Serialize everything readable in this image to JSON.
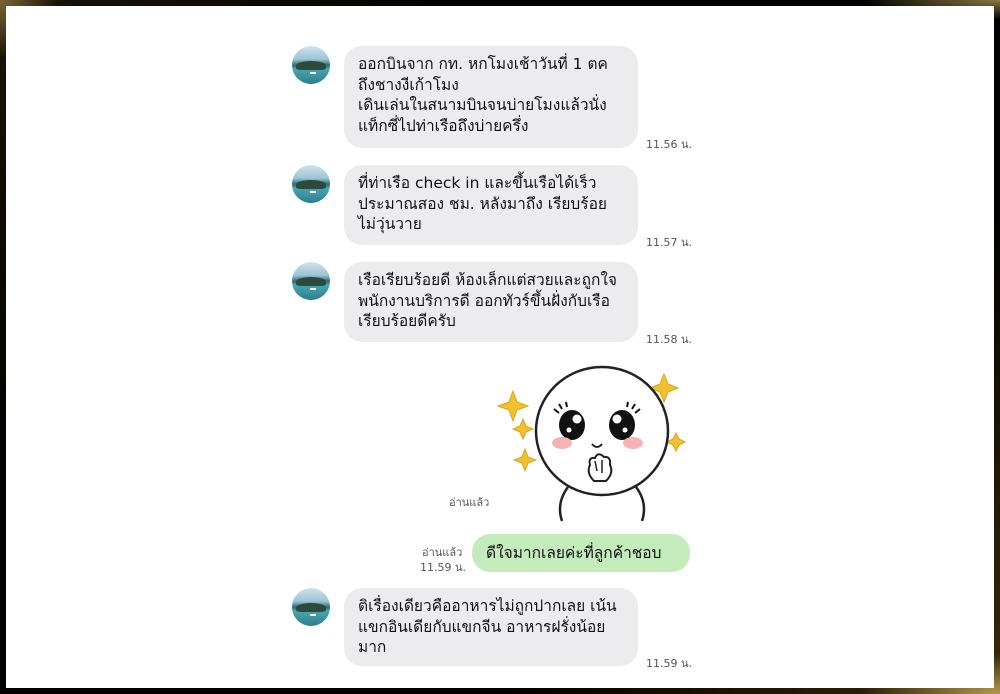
{
  "messages": [
    {
      "lines": [
        "ออกบินจาก กท. หกโมงเช้าวันที่ 1 ตค",
        "ถึงชางงีเก้าโมง",
        "เดินเล่นในสนามบินจนบ่ายโมงแล้วนั่ง",
        "แท็กซี่ไปท่าเรือถึงบ่ายครึ่ง"
      ],
      "time": "11.56 น."
    },
    {
      "lines": [
        "ที่ท่าเรือ check in และขึ้นเรือได้เร็ว",
        "ประมาณสอง ชม. หลังมาถึง เรียบร้อย",
        "ไม่วุ่นวาย"
      ],
      "time": "11.57 น."
    },
    {
      "lines": [
        "เรือเรียบร้อยดี ห้องเล็กแต่สวยและถูกใจ",
        "พนักงานบริการดี ออกทัวร์ขึ้นฝั่งกับเรือ",
        "เรียบร้อยดีครับ"
      ],
      "time": "11.58 น."
    },
    {
      "lines": [
        "ติเรื่องเดียวคืออาหารไม่ถูกปากเลย เน้น",
        "แขกอินเดียกับแขกจีน อาหารฝรั่งน้อย",
        "มาก"
      ],
      "time": "11.59 น."
    }
  ],
  "sticker": {
    "read_label": "อ่านแล้ว",
    "icon": "happy-face-sticker",
    "star_color": "#f2c12e"
  },
  "reply": {
    "read_label": "อ่านแล้ว",
    "time": "11.59 น.",
    "text": "ดีใจมากเลยค่ะที่ลูกค้าชอบ",
    "color": "#c3ebbb"
  },
  "colors": {
    "incoming_bubble": "#ececee",
    "frame_gold": "#d8b65a"
  }
}
